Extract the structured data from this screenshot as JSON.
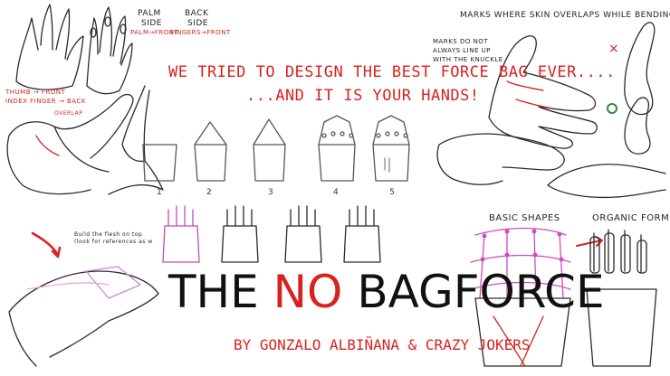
{
  "labels": {
    "palm_side": "PALM",
    "palm_side2": "SIDE",
    "palm_front": "PALM→FRONT",
    "back_side": "BACK",
    "back_side2": "SIDE",
    "fingers_front": "FINGERS→FRONT",
    "thumb_front": "THUMB → FRONT",
    "index_back": "INDEX FINGER → BACK",
    "overlap": "OVERLAP",
    "marks_title": "MARKS WHERE SKIN OVERLAPS WHILE BENDING",
    "marks_note1": "MARKS DO NOT",
    "marks_note2": "ALWAYS LINE UP",
    "marks_note3": "WITH THE KNUCKLE",
    "cross": "×",
    "flesh_note1": "Build the flesh on top",
    "flesh_note2": "(look for references as w",
    "basic_shapes": "BASIC SHAPES",
    "organic_form": "ORGANIC FORM"
  },
  "steps": [
    "1",
    "2",
    "3",
    "4",
    "5"
  ],
  "headline": {
    "line1": "WE TRIED TO DESIGN THE BEST FORCE BAG EVER....",
    "line2": "...AND IT IS YOUR HANDS!"
  },
  "title": {
    "part1": "THE",
    "part2": "NO",
    "part3": "BAG",
    "part4": "FORCE"
  },
  "subtitle": "BY GONZALO ALBIÑANA & CRAZY JOKERS",
  "colors": {
    "accent_red": "#d8221f",
    "sketch_ink": "#2a2a2a",
    "pink_guide": "#d14bbd",
    "check_green": "#2f8a3a"
  }
}
